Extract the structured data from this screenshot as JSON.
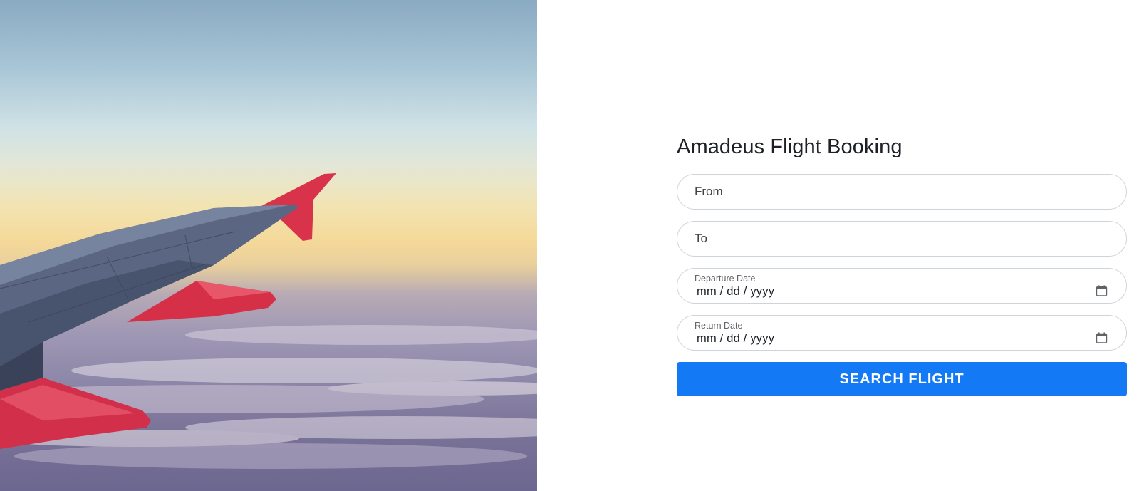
{
  "hero": {
    "image_icon": "airplane-wing-over-clouds"
  },
  "form": {
    "title": "Amadeus Flight Booking",
    "from": {
      "placeholder": "From",
      "value": ""
    },
    "to": {
      "placeholder": "To",
      "value": ""
    },
    "departure": {
      "label": "Departure Date",
      "value": "mm / dd / yyyy",
      "icon": "calendar-icon"
    },
    "return": {
      "label": "Return Date",
      "value": "mm / dd / yyyy",
      "icon": "calendar-icon"
    },
    "submit_label": "SEARCH FLIGHT"
  },
  "colors": {
    "accent": "#1479f5",
    "wing_red": "#e0304a",
    "border": "#ced4da"
  }
}
